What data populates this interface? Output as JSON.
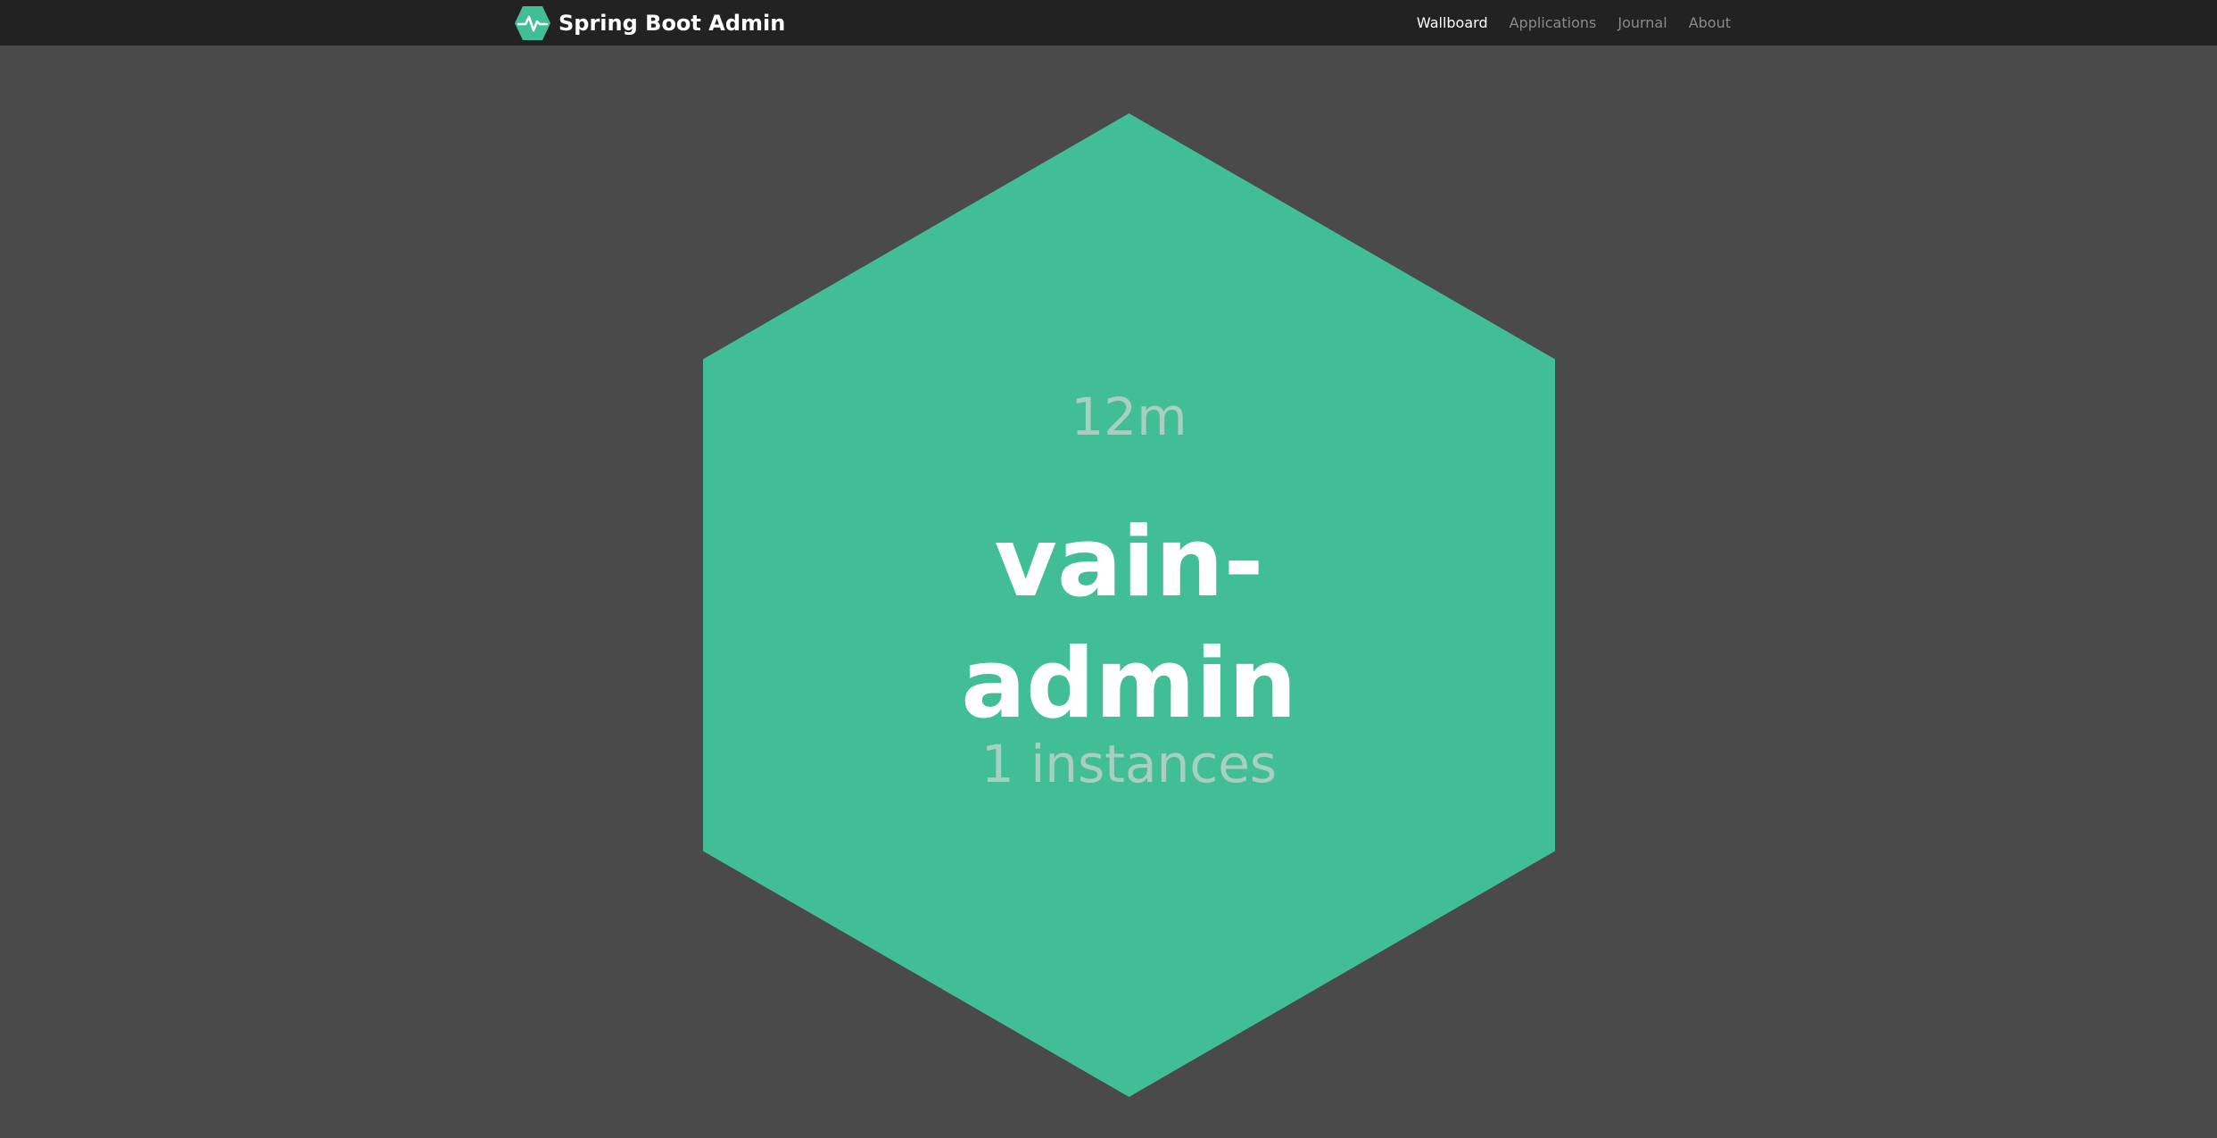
{
  "navbar": {
    "brand_title": "Spring Boot Admin",
    "brand_icon": "heartbeat-hexagon-icon",
    "items": [
      {
        "label": "Wallboard",
        "active": true
      },
      {
        "label": "Applications",
        "active": false
      },
      {
        "label": "Journal",
        "active": false
      },
      {
        "label": "About",
        "active": false
      }
    ]
  },
  "wallboard": {
    "applications": [
      {
        "name_line1": "vain-",
        "name_line2": "admin",
        "uptime": "12m",
        "instances": "1 instances",
        "status_color": "#42be96"
      }
    ]
  },
  "colors": {
    "navbar_bg": "#222222",
    "page_bg": "#4a4a4a",
    "brand_accent": "#42be96",
    "hex_fill": "#42be96"
  }
}
